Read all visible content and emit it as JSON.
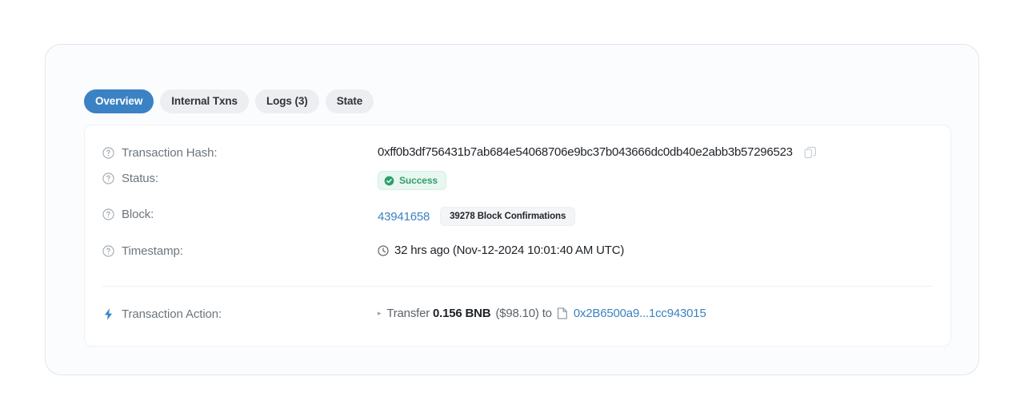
{
  "tabs": [
    {
      "label": "Overview",
      "active": true
    },
    {
      "label": "Internal Txns",
      "active": false
    },
    {
      "label": "Logs (3)",
      "active": false
    },
    {
      "label": "State",
      "active": false
    }
  ],
  "details": {
    "hash": {
      "label": "Transaction Hash:",
      "value": "0xff0b3df756431b7ab684e54068706e9bc37b043666dc0db40e2abb3b57296523",
      "copy_icon": "copy-icon",
      "help_icon": "question-circle-icon"
    },
    "status": {
      "label": "Status:",
      "value": "Success",
      "badge_icon": "check-circle-icon",
      "help_icon": "question-circle-icon"
    },
    "block": {
      "label": "Block:",
      "number": "43941658",
      "confirmations": "39278 Block Confirmations",
      "help_icon": "question-circle-icon"
    },
    "timestamp": {
      "label": "Timestamp:",
      "value": "32 hrs ago (Nov-12-2024 10:01:40 AM UTC)",
      "clock_icon": "clock-icon",
      "help_icon": "question-circle-icon"
    },
    "action": {
      "label": "Transaction Action:",
      "bolt_icon": "lightning-bolt-icon",
      "caret": "▸",
      "verb": "Transfer",
      "amount": "0.156 BNB",
      "usd": "($98.10)",
      "preposition": "to",
      "doc_icon": "document-icon",
      "address": "0x2B6500a9...1cc943015"
    }
  },
  "colors": {
    "accent_blue": "#3b82c4",
    "link_blue": "#3b82c4",
    "success_green": "#2f9e6e",
    "success_bg": "#e8f7f0",
    "label_gray": "#6c757d",
    "card_bg": "#fbfcfd",
    "card_border": "#dfe7ee"
  }
}
